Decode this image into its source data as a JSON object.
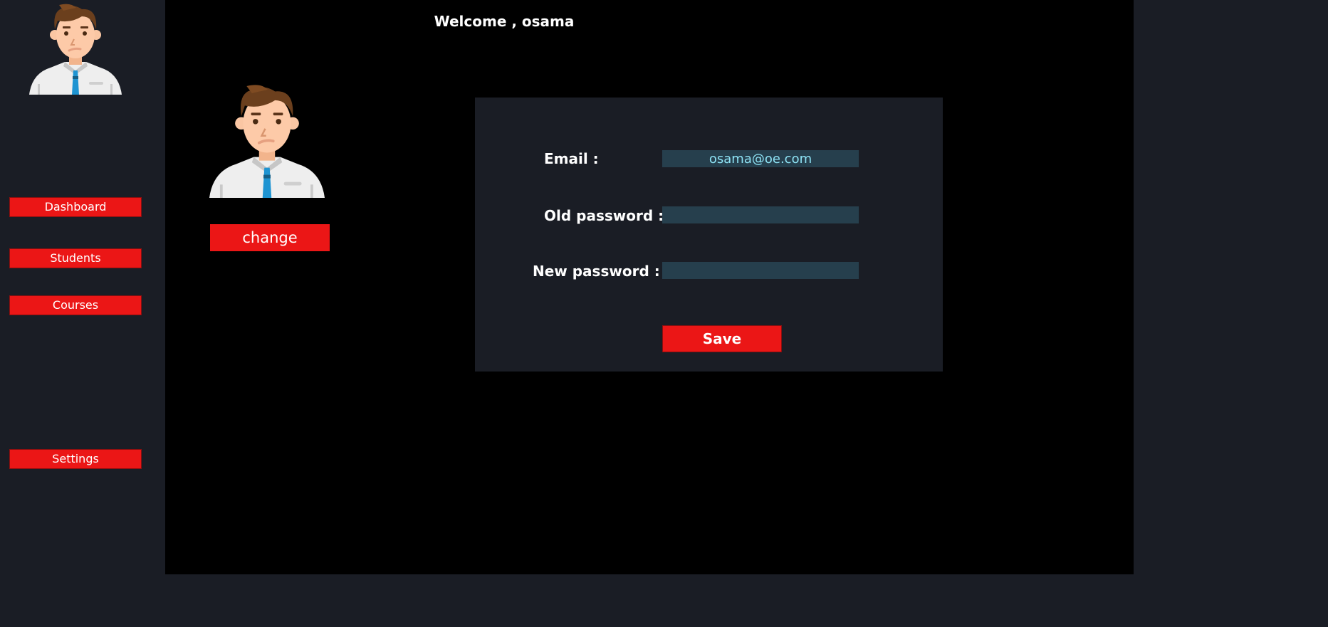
{
  "header": {
    "welcome": "Welcome , osama"
  },
  "sidebar": {
    "avatar_icon": "user-avatar-icon",
    "items": [
      {
        "label": "Dashboard"
      },
      {
        "label": "Students"
      },
      {
        "label": "Courses"
      },
      {
        "label": "Settings"
      }
    ]
  },
  "profile": {
    "avatar_icon": "user-avatar-icon",
    "change_label": "change"
  },
  "form": {
    "email_label": "Email :",
    "email_value": "osama@oe.com",
    "old_password_label": "Old password :",
    "old_password_value": "",
    "new_password_label": "New password :",
    "new_password_value": "",
    "save_label": "Save"
  },
  "colors": {
    "accent": "#eb1616",
    "sidebar_bg": "#1a1d25",
    "main_bg": "#000000",
    "input_bg": "#263f4d",
    "input_text": "#8ee3f5"
  }
}
